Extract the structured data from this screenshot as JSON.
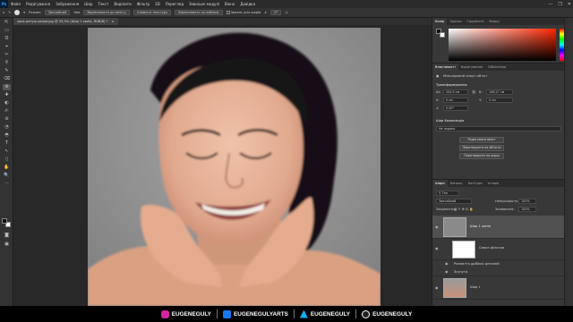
{
  "menu": {
    "logo": "Ps",
    "items": [
      "Файл",
      "Редагування",
      "Зображення",
      "Шар",
      "Текст",
      "Виділити",
      "Фільтр",
      "3D",
      "Перегляд",
      "Зовнішні модулі",
      "Вікно",
      "Довідка"
    ]
  },
  "window_controls": [
    "—",
    "❐",
    "✕"
  ],
  "options_bar": {
    "mode_label": "Режим:",
    "mode_value": "Звичайний",
    "new_label": "Нов",
    "btn1": "Вирівнювати до вмісту",
    "btn2": "Оновити текстуру",
    "btn3": "Вирівнювати за наближ",
    "check_label": "Зразок усіх шарів",
    "angle": "0°"
  },
  "document_tab": {
    "title": "урок ретуш шкіри.jpg @ 33,3% (Шар 1 копія, RGB/8) *",
    "close": "×"
  },
  "tools": [
    "⇱",
    "▭",
    "ʘ",
    "⌖",
    "✂",
    "⚲",
    "✎",
    "⌫",
    "⊕",
    "✚",
    "◐",
    "✍",
    "⊘",
    "◔",
    "◓",
    "T",
    "↖",
    "▯",
    "✋",
    "🔍",
    "⋯"
  ],
  "color_panel": {
    "tabs": [
      "Колір",
      "Зразки",
      "Градієнти",
      "Взірці"
    ],
    "fg_color": "#111111",
    "bg_color": "#ffffff",
    "hue_color": "#ff2600"
  },
  "properties_panel": {
    "tabs": [
      "Властивості",
      "Коригування",
      "Бібліотеки"
    ],
    "layer_kind": "Міжшаровий смарт-об'єкт",
    "transform_title": "Трансформування",
    "w_label": "Ш:",
    "w_value": "204,9 см",
    "h_label": "В:",
    "h_value": "146,27 см",
    "x_label": "X:",
    "x_value": "0 см",
    "y_label": "Y:",
    "y_value": "0 см",
    "angle_value": "0,00°",
    "composition_title": "Шар Композиція",
    "composition_value": "Не задано",
    "buttons": [
      "Редагувати вміст",
      "Перетворити на об'єкти",
      "Перетворити на шари"
    ]
  },
  "layers_panel": {
    "tabs": [
      "Шари",
      "Канали",
      "Контури",
      "Історія"
    ],
    "filter_label": "Тип",
    "blend_mode": "Звичайний",
    "opacity_label": "Непрозорість:",
    "opacity_value": "100%",
    "lock_label": "Закріпити:",
    "fill_label": "Заливання:",
    "fill_value": "100%",
    "layers": [
      {
        "name": "Шар 1 копія"
      },
      {
        "name": "Смарт-фільтри"
      },
      {
        "name": "Розмиття дрібних деталей"
      },
      {
        "name": "Зсунути"
      },
      {
        "name": "Шар 1"
      }
    ]
  },
  "social": {
    "instagram": "EUGENEGULY",
    "facebook": "EUGENEGULYARTS",
    "artstation": "EUGENEGULY",
    "tiktok": "EUGENEGULY",
    "colors": {
      "instagram": "#d6249f",
      "facebook": "#1877f2",
      "artstation": "#13aff0",
      "tiktok": "#222222"
    }
  }
}
